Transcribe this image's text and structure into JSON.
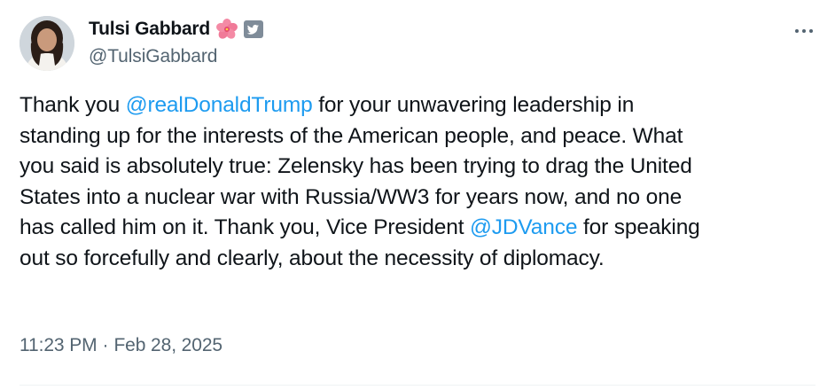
{
  "author": {
    "display_name": "Tulsi Gabbard",
    "flower_emoji": "🌺",
    "handle": "@TulsiGabbard"
  },
  "tweet": {
    "lines": [
      [
        {
          "t": "Thank you "
        },
        {
          "t": "@realDonaldTrump",
          "mention": true
        },
        {
          "t": " for your unwavering leadership in"
        }
      ],
      [
        {
          "t": "standing up for the interests of the American people, and peace. What"
        }
      ],
      [
        {
          "t": "you said is absolutely true: Zelensky has been trying to drag the United"
        }
      ],
      [
        {
          "t": "States into a nuclear war with Russia/WW3 for years now, and no one"
        }
      ],
      [
        {
          "t": "has called him on it. Thank you, Vice President "
        },
        {
          "t": "@JDVance",
          "mention": true
        },
        {
          "t": " for speaking"
        }
      ],
      [
        {
          "t": "out so forcefully and clearly, about the necessity of diplomacy."
        }
      ]
    ]
  },
  "meta": {
    "time": "11:23 PM",
    "separator": "·",
    "date": "Feb 28, 2025"
  },
  "colors": {
    "link": "#1d9bf0",
    "secondary_text": "#536471",
    "primary_text": "#0f1419"
  },
  "icons": {
    "more": "more-horizontal-icon",
    "badge": "government-badge-icon",
    "flower": "hibiscus-icon"
  }
}
